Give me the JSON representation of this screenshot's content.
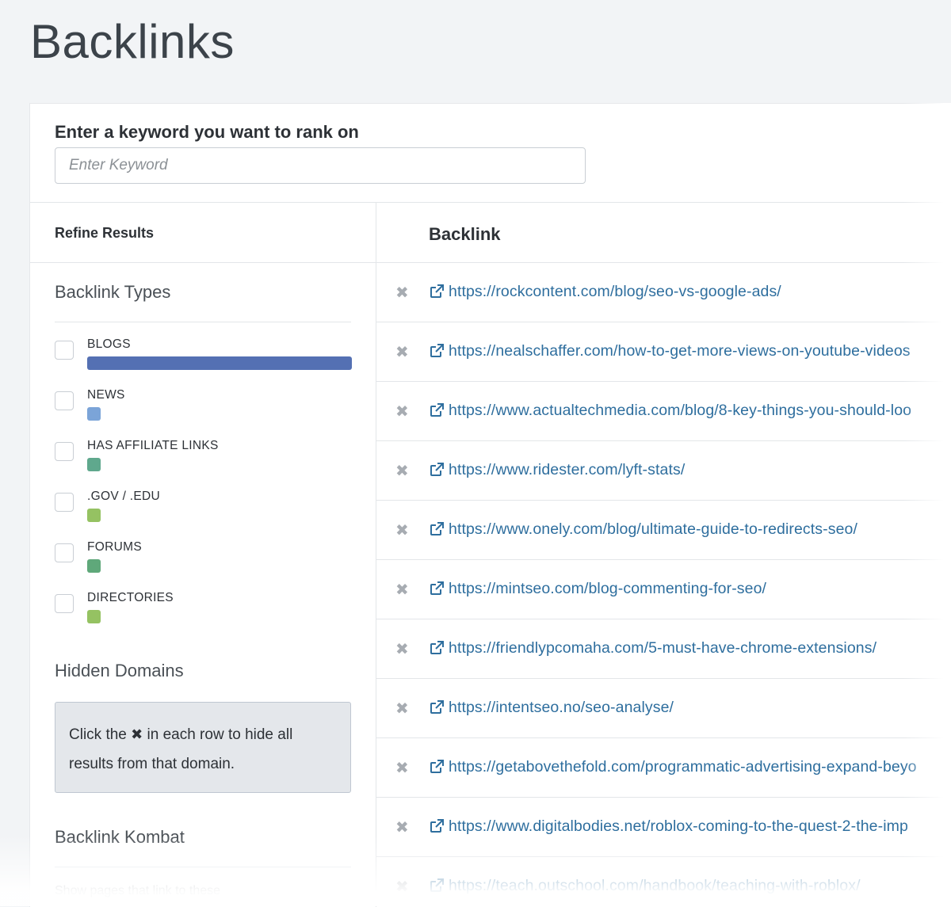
{
  "page": {
    "title": "Backlinks"
  },
  "keyword": {
    "label": "Enter a keyword you want to rank on",
    "placeholder": "Enter Keyword",
    "value": ""
  },
  "sidebar": {
    "refine_label": "Refine Results",
    "backlink_types_title": "Backlink Types",
    "filters": [
      {
        "label": "BLOGS",
        "color": "#5470b3",
        "level": 1.0
      },
      {
        "label": "NEWS",
        "color": "#7ba4d8",
        "level": 0.05
      },
      {
        "label": "HAS AFFILIATE LINKS",
        "color": "#5fa88d",
        "level": 0.05
      },
      {
        "label": ".GOV / .EDU",
        "color": "#95c262",
        "level": 0.05
      },
      {
        "label": "FORUMS",
        "color": "#5fa87a",
        "level": 0.05
      },
      {
        "label": "DIRECTORIES",
        "color": "#95c262",
        "level": 0.05
      }
    ],
    "hidden_domains_title": "Hidden Domains",
    "hint_before": "Click the",
    "hint_icon": "✖",
    "hint_after": "in each row to hide all results from that domain.",
    "kombat_title": "Backlink Kombat",
    "kombat_desc": "Show pages that link to these"
  },
  "results": {
    "header": "Backlink",
    "rows": [
      "https://rockcontent.com/blog/seo-vs-google-ads/",
      "https://nealschaffer.com/how-to-get-more-views-on-youtube-videos",
      "https://www.actualtechmedia.com/blog/8-key-things-you-should-loo",
      "https://www.ridester.com/lyft-stats/",
      "https://www.onely.com/blog/ultimate-guide-to-redirects-seo/",
      "https://mintseo.com/blog-commenting-for-seo/",
      "https://friendlypcomaha.com/5-must-have-chrome-extensions/",
      "https://intentseo.no/seo-analyse/",
      "https://getabovethefold.com/programmatic-advertising-expand-beyo",
      "https://www.digitalbodies.net/roblox-coming-to-the-quest-2-the-imp",
      "https://teach.outschool.com/handbook/teaching-with-roblox/"
    ]
  }
}
